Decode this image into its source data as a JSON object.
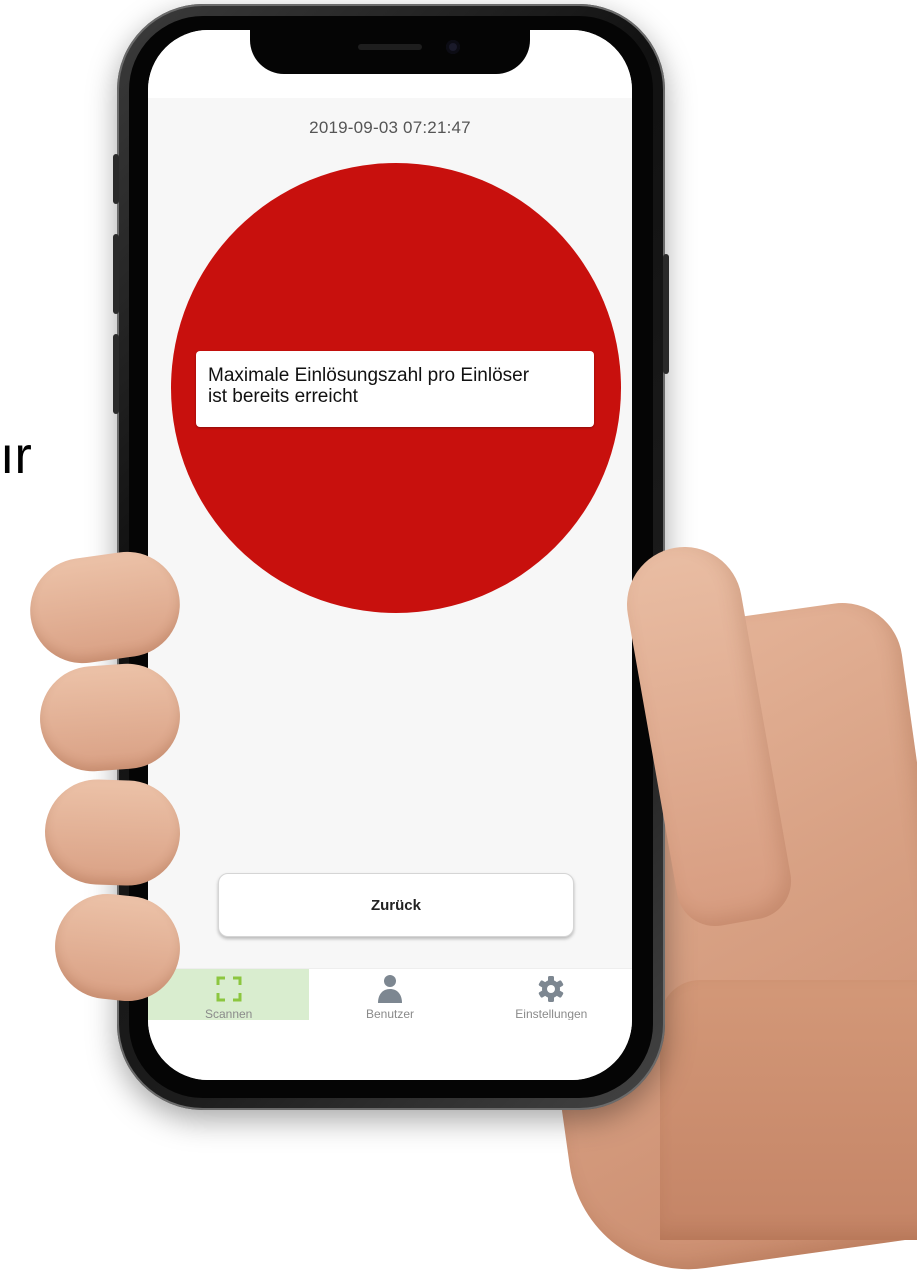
{
  "background": {
    "stray_text": "ır"
  },
  "status": {
    "timestamp": "2019-09-03 07:21:47"
  },
  "result": {
    "indicator_color": "#c8100d",
    "message_line1": "Maximale Einlösungszahl pro Einlöser",
    "message_line2": "ist bereits erreicht"
  },
  "actions": {
    "back_label": "Zurück"
  },
  "bottom_nav": {
    "active_color": "#d9edcf",
    "accent_color": "#8cc63f",
    "items": [
      {
        "label": "Scannen",
        "icon": "scan-icon",
        "active": true
      },
      {
        "label": "Benutzer",
        "icon": "user-icon",
        "active": false
      },
      {
        "label": "Einstellungen",
        "icon": "gear-icon",
        "active": false
      }
    ]
  }
}
